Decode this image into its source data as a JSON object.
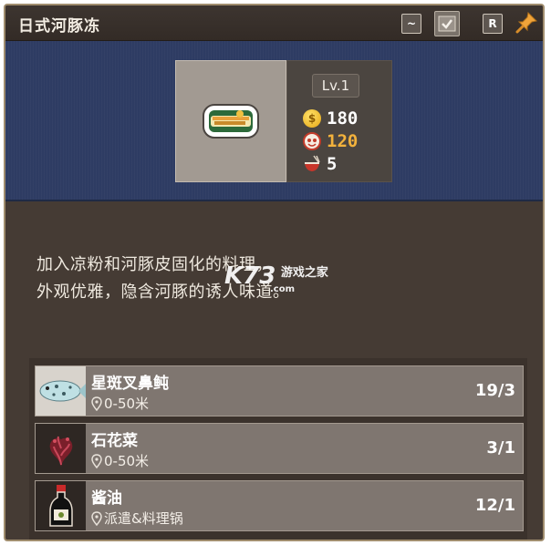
{
  "header": {
    "title": "日式河豚冻",
    "buttons": [
      {
        "name": "wave",
        "label": "~"
      },
      {
        "name": "check",
        "label": ""
      },
      {
        "name": "r",
        "label": "R"
      }
    ]
  },
  "recipe": {
    "level": "Lv.1",
    "price": "180",
    "appeal": "120",
    "portions": "5"
  },
  "description": {
    "line1": "加入凉粉和河豚皮固化的料理，",
    "line2": "外观优雅，隐含河豚的诱人味道。"
  },
  "watermark": {
    "logo": "K73",
    "text": "游戏之家",
    "domain": ".com"
  },
  "ingredients": [
    {
      "name": "星斑叉鼻鲀",
      "location": "0-50米",
      "count": "19/3"
    },
    {
      "name": "石花菜",
      "location": "0-50米",
      "count": "3/1"
    },
    {
      "name": "酱油",
      "location": "派遣&料理锅",
      "count": "12/1"
    }
  ],
  "colors": {
    "panel_bg": "#453b34",
    "header_bg": "#3d3530",
    "band_bg": "#2e3c63",
    "price_color": "#ffffff",
    "appeal_color": "#f3b23c",
    "portions_color": "#ffffff",
    "coin_gold": "#f2c02e"
  },
  "icons": [
    "wave-icon",
    "check-icon",
    "r-key-icon",
    "pin-icon",
    "coin-icon",
    "appeal-icon",
    "bowl-icon",
    "location-pin-icon",
    "pufferfish-icon",
    "seaweed-icon",
    "soy-sauce-icon",
    "dish-icon"
  ]
}
